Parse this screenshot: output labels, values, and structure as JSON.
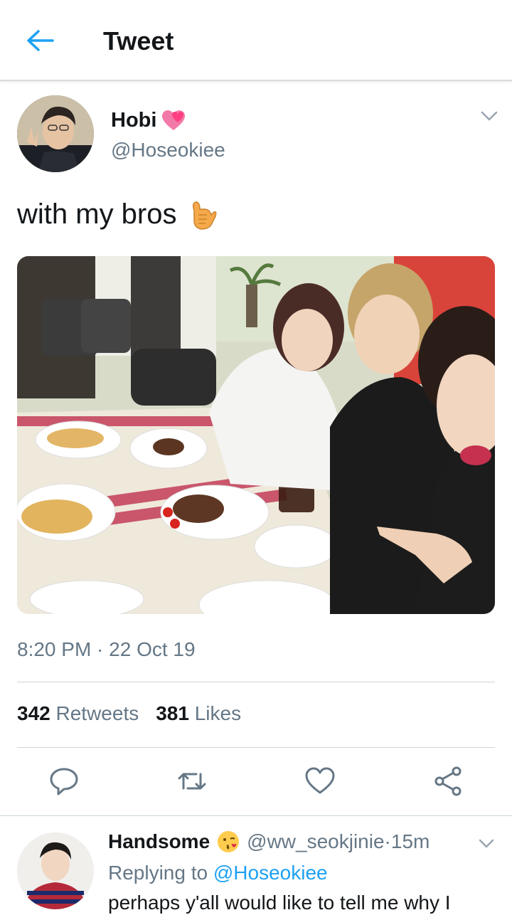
{
  "header": {
    "title": "Tweet"
  },
  "tweet": {
    "author_name": "Hobi",
    "author_handle": "@Hoseokiee",
    "text": "with my bros",
    "timestamp": "8:20 PM · 22 Oct 19",
    "retweets_count": "342",
    "retweets_label": "Retweets",
    "likes_count": "381",
    "likes_label": "Likes"
  },
  "actions": [
    "reply-icon",
    "retweet-icon",
    "like-icon",
    "share-icon"
  ],
  "reply": {
    "name": "Handsome",
    "handle": "@ww_seokjinie",
    "dot": " · ",
    "time": "15m",
    "replying_prefix": "Replying to ",
    "replying_to": "@Hoseokiee",
    "text": "perhaps y'all would like to tell me why I"
  },
  "colors": {
    "accent": "#1da1f2",
    "secondary_text": "#657786",
    "divider": "#ccd6dd"
  }
}
